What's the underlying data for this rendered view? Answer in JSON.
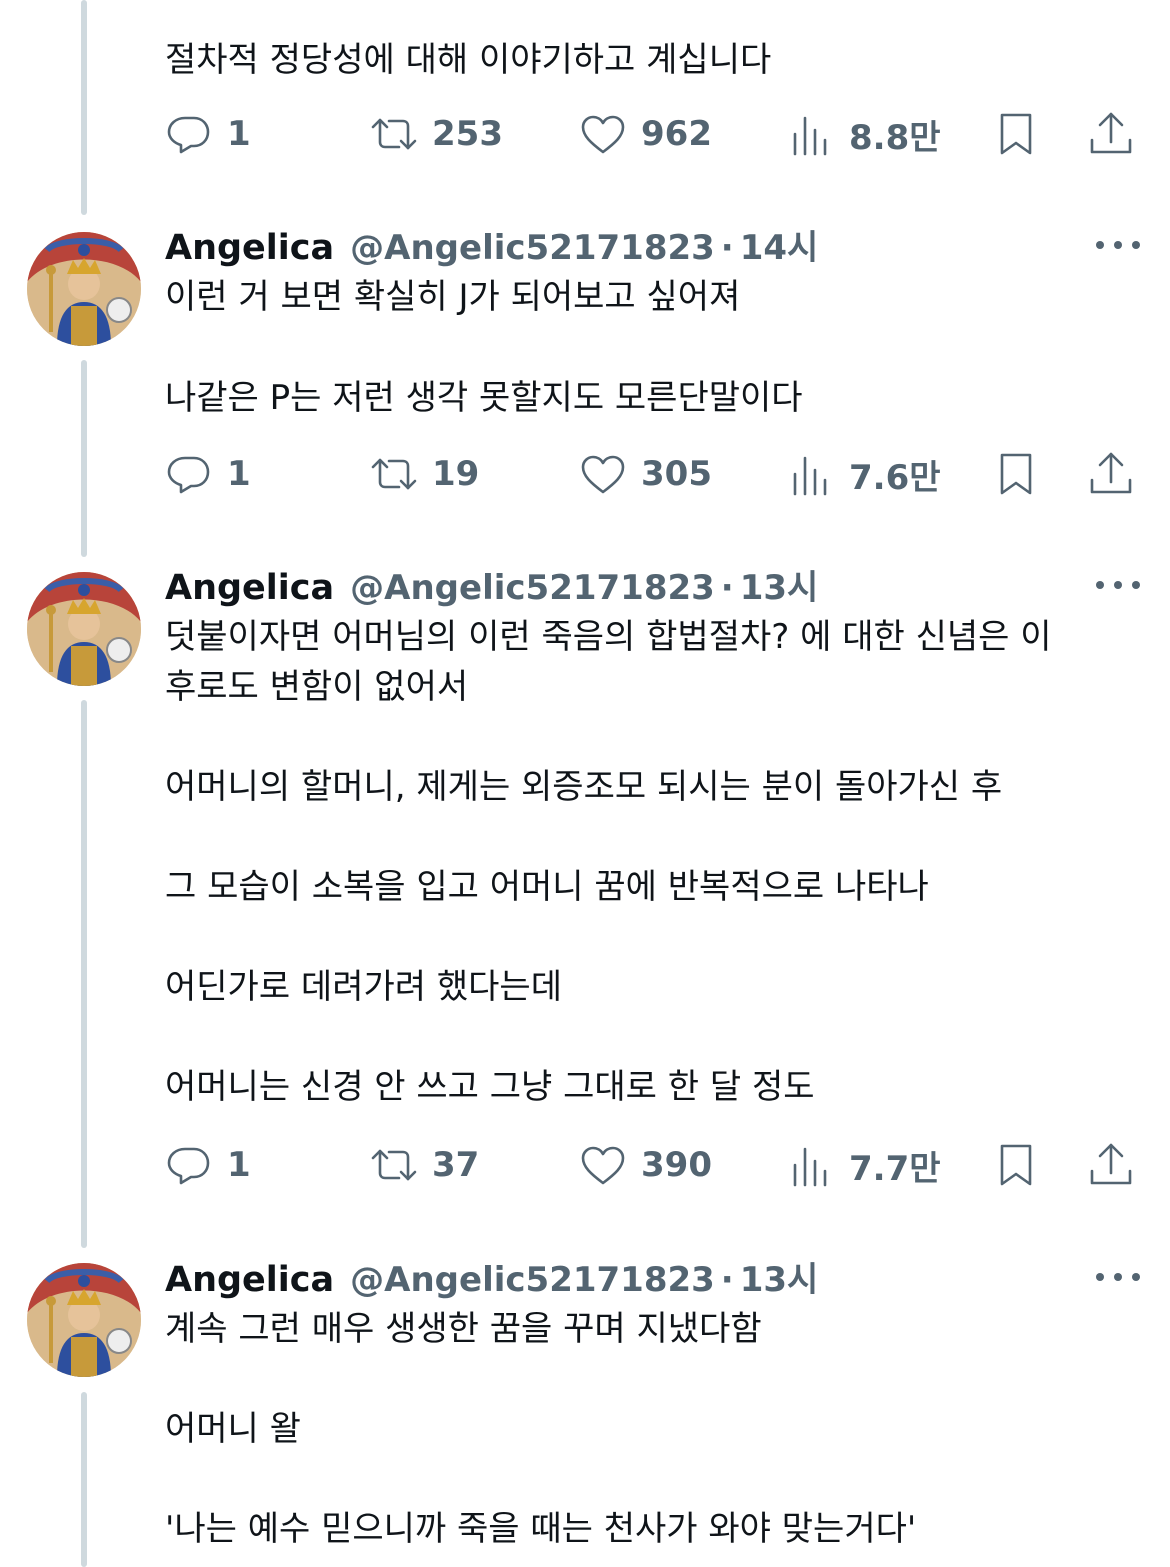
{
  "tweets": [
    {
      "partial": true,
      "text": "절차적 정당성에 대해 이야기하고 계십니다",
      "stats": {
        "replies": "1",
        "retweets": "253",
        "likes": "962",
        "views": "8.8만"
      }
    },
    {
      "name": "Angelica",
      "handle": "@Angelic52171823",
      "dot": "·",
      "time": "14시",
      "paragraphs": [
        "이런 거 보면 확실히 J가 되어보고 싶어져",
        "나같은 P는 저런 생각 못할지도 모른단말이다"
      ],
      "stats": {
        "replies": "1",
        "retweets": "19",
        "likes": "305",
        "views": "7.6만"
      }
    },
    {
      "name": "Angelica",
      "handle": "@Angelic52171823",
      "dot": "·",
      "time": "13시",
      "paragraphs": [
        "덧붙이자면 어머님의 이런 죽음의 합법절차? 에 대한 신념은 이\n후로도 변함이 없어서",
        "어머니의 할머니, 제게는 외증조모 되시는 분이 돌아가신 후",
        "그 모습이 소복을 입고 어머니 꿈에 반복적으로 나타나",
        "어딘가로 데려가려 했다는데",
        "어머니는 신경 안 쓰고 그냥 그대로 한 달 정도"
      ],
      "stats": {
        "replies": "1",
        "retweets": "37",
        "likes": "390",
        "views": "7.7만"
      }
    },
    {
      "name": "Angelica",
      "handle": "@Angelic52171823",
      "dot": "·",
      "time": "13시",
      "paragraphs": [
        "계속 그런 매우 생생한 꿈을 꾸며 지냈다함",
        "어머니 왈",
        "'나는 예수 믿으니까 죽을 때는 천사가 와야 맞는거다'"
      ]
    }
  ],
  "icons": {
    "reply": "speech-bubble-icon",
    "retweet": "retweet-arrows-icon",
    "like": "heart-icon",
    "views": "bar-chart-icon",
    "bookmark": "bookmark-icon",
    "share": "share-upload-icon",
    "more": "more-dots-icon"
  },
  "colors": {
    "text": "#0f1419",
    "secondary": "#536471",
    "thread_line": "#cfd9de"
  }
}
